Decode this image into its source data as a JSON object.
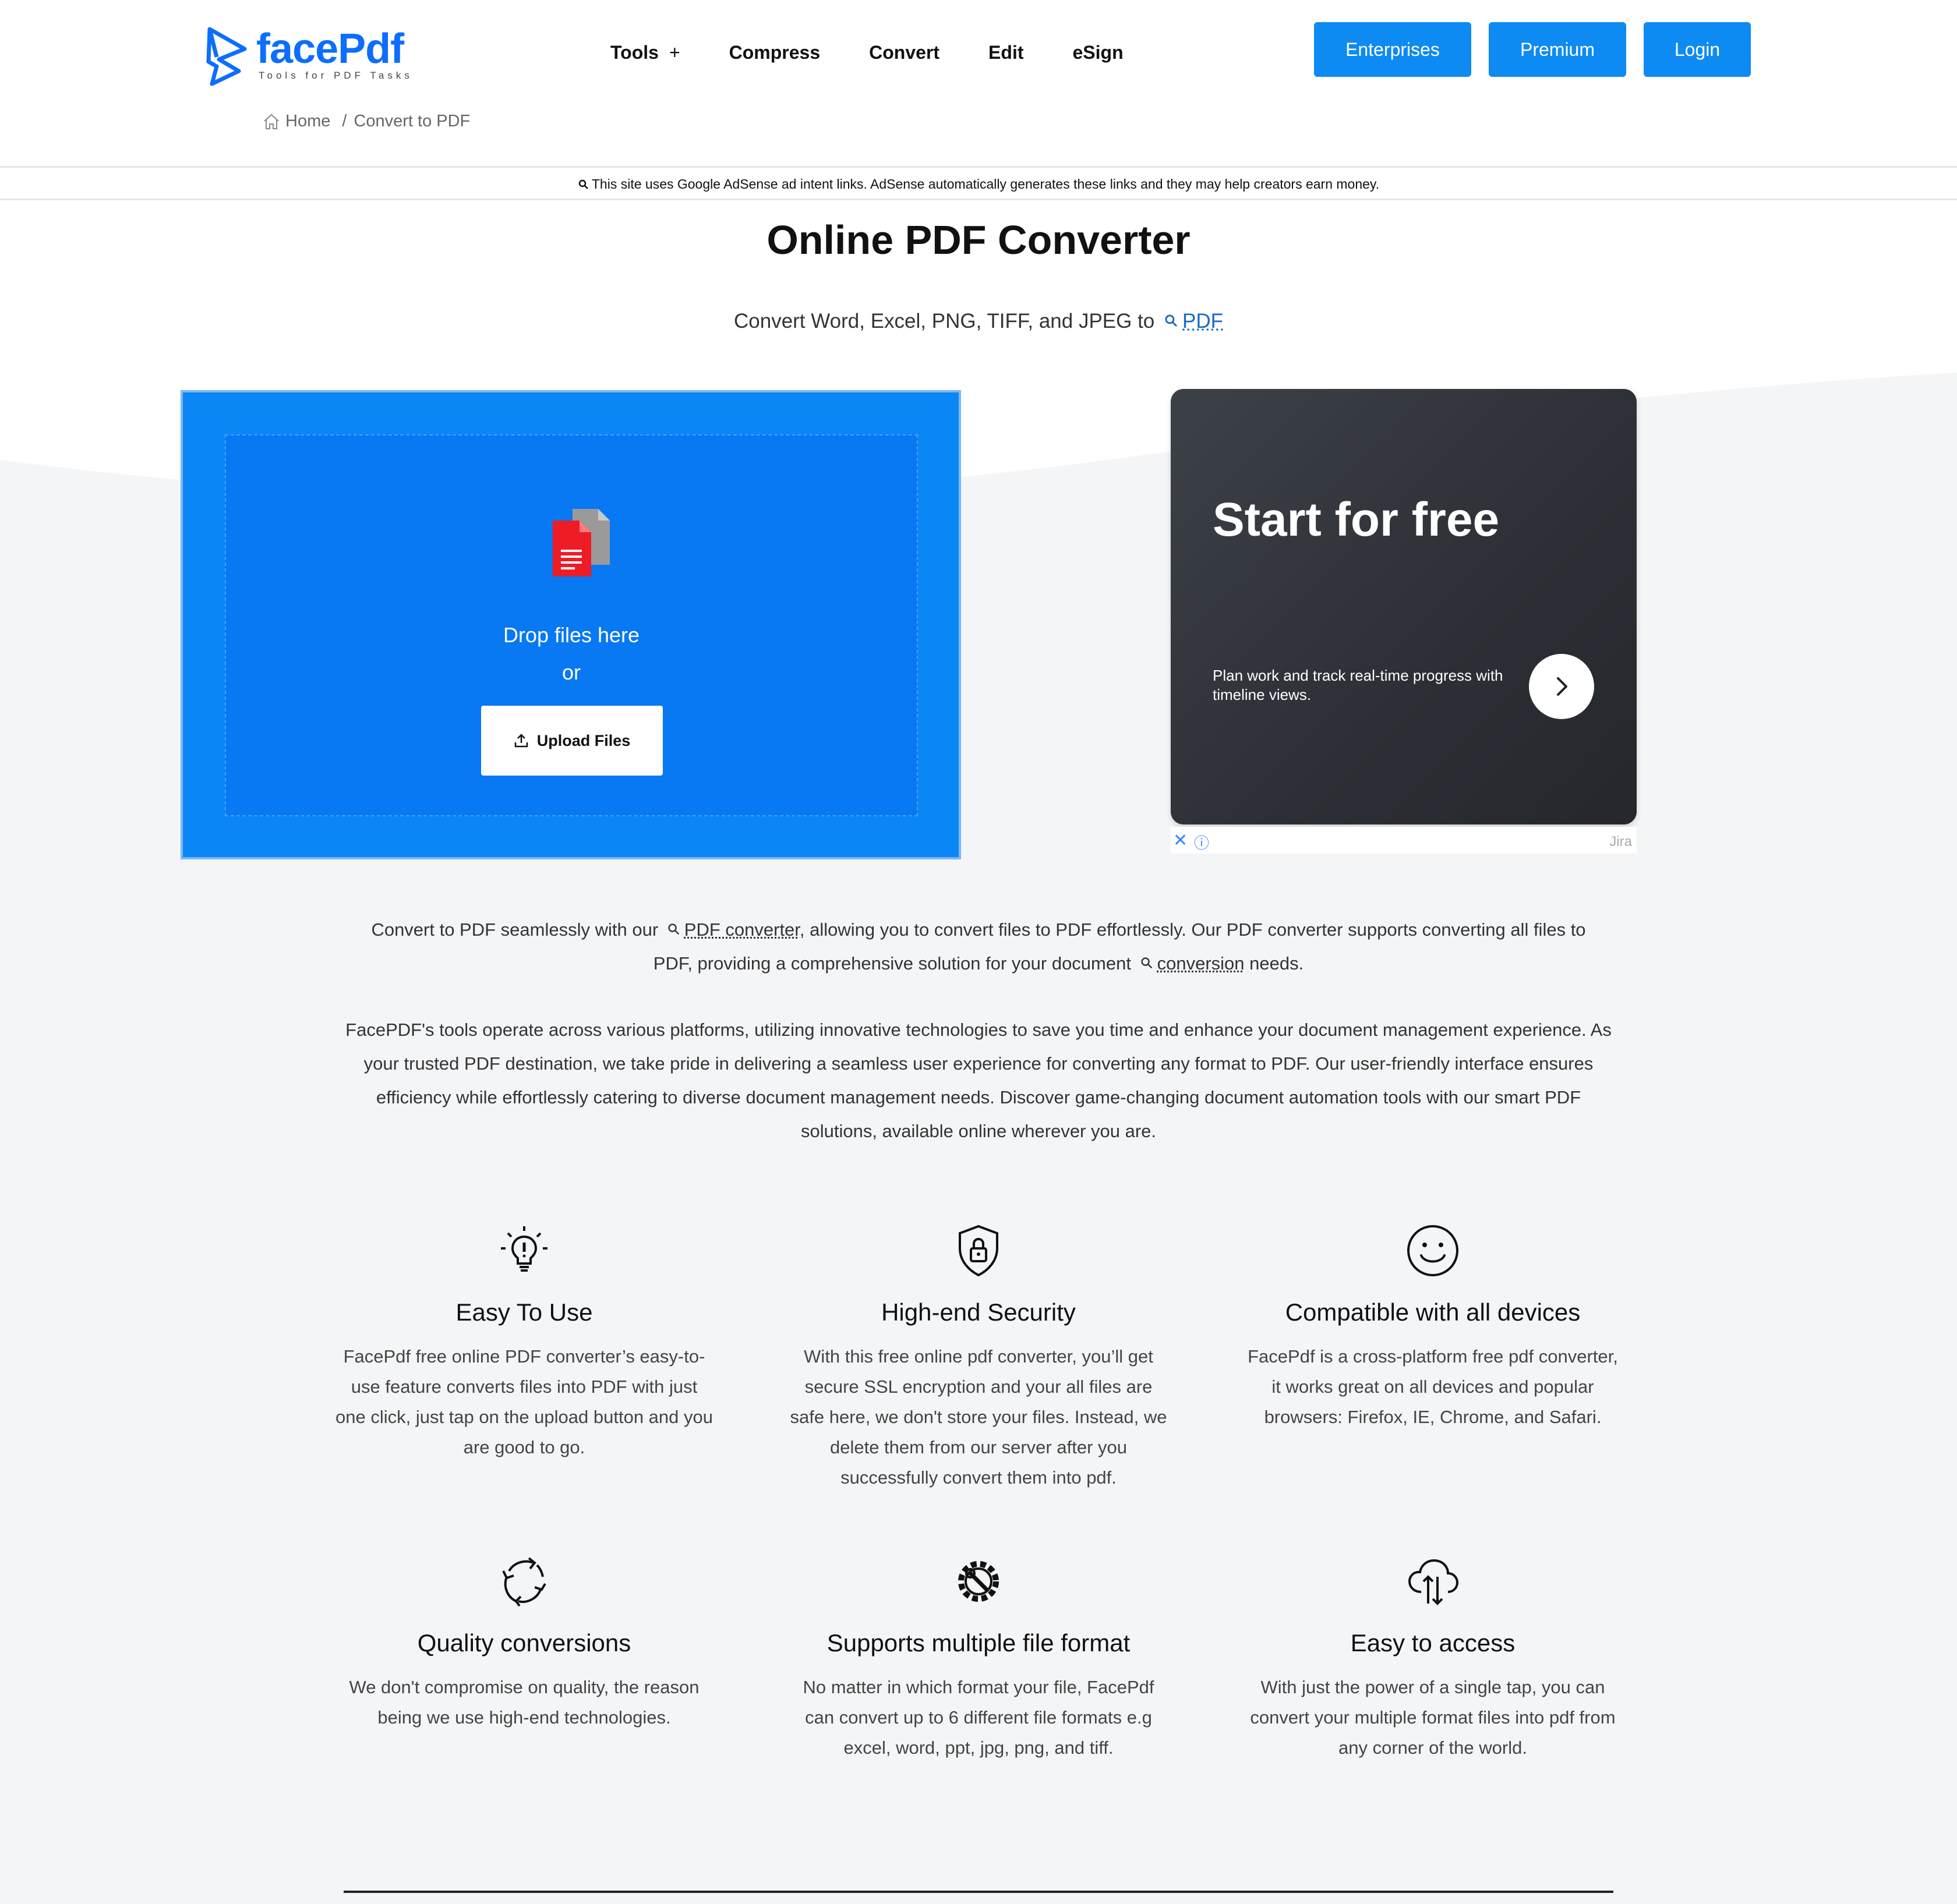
{
  "header": {
    "logo_name": "facePdf",
    "logo_tagline": "Tools for PDF Tasks",
    "nav": [
      "Tools",
      "Compress",
      "Convert",
      "Edit",
      "eSign"
    ],
    "nav_tools_suffix": "+",
    "buttons": {
      "enterprises": "Enterprises",
      "premium": "Premium",
      "login": "Login"
    },
    "breadcrumb": {
      "home": "Home",
      "sep": "/",
      "current": "Convert to PDF"
    }
  },
  "adsense_note": "This site uses Google AdSense ad intent links. AdSense automatically generates these links and they may help creators earn money.",
  "main": {
    "title": "Online PDF Converter",
    "subtitle_prefix": "Convert Word, Excel, PNG, TIFF, and JPEG to",
    "subtitle_link": "PDF"
  },
  "upload": {
    "drop_text": "Drop files here",
    "or_text": "or",
    "button": "Upload Files"
  },
  "ad": {
    "headline": "Start for free",
    "body": "Plan work and track real-time progress with timeline views.",
    "close": "✕",
    "info": "ⓘ",
    "brand": "Jira"
  },
  "intro": {
    "p1_a": "Convert to PDF seamlessly with our",
    "p1_link1": "PDF converter",
    "p1_b": ", allowing you to convert files to PDF effortlessly. Our PDF converter supports converting all files to",
    "p1_c": "PDF, providing a comprehensive solution for your document",
    "p1_link2": "conversion",
    "p1_d": "needs.",
    "p2_lines": [
      "FacePDF's tools operate across various platforms, utilizing innovative technologies to save you time and enhance your document management experience. As",
      "your trusted PDF destination, we take pride in delivering a seamless user experience for converting any format to PDF. Our user-friendly interface ensures",
      "efficiency while effortlessly catering to diverse document management needs. Discover game-changing document automation tools with our smart PDF",
      "solutions, available online wherever you are."
    ]
  },
  "features": [
    {
      "icon": "lightbulb-icon",
      "title": "Easy To Use",
      "lines": [
        "FacePdf free online PDF converter’s easy-to-",
        "use feature converts files into PDF with just",
        "one click, just tap on the upload button and you",
        "are good to go."
      ]
    },
    {
      "icon": "shield-lock-icon",
      "title": "High-end Security",
      "lines": [
        "With this free online pdf converter, you’ll get",
        "secure SSL encryption and your all files are",
        "safe here, we don't store your files. Instead, we",
        "delete them from our server after you",
        "successfully convert them into pdf."
      ]
    },
    {
      "icon": "smiley-icon",
      "title": "Compatible with all devices",
      "lines": [
        "FacePdf is a cross-platform free pdf converter,",
        "it works great on all devices and popular",
        "browsers: Firefox, IE, Chrome, and Safari."
      ]
    },
    {
      "icon": "refresh-icon",
      "title": "Quality conversions",
      "lines": [
        "We don't compromise on quality, the reason",
        "being we use high-end technologies."
      ]
    },
    {
      "icon": "gear-wrench-icon",
      "title": "Supports multiple file format",
      "lines": [
        "No matter in which format your file, FacePdf",
        "can convert up to 6 different file formats e.g",
        "excel, word, ppt, jpg, png, and tiff."
      ]
    },
    {
      "icon": "cloud-transfer-icon",
      "title": "Easy to access",
      "lines": [
        "With just the power of a single tap, you can",
        "convert your multiple format files into pdf from",
        "any corner of the world."
      ]
    }
  ],
  "colors": {
    "brand": "#0d6efd",
    "button": "#0d8bf2",
    "upload_bg": "#0a87f5",
    "link": "#1769c2"
  }
}
